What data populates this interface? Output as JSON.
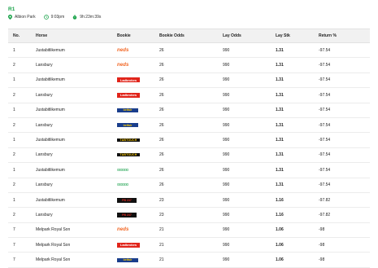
{
  "race": {
    "title": "R1",
    "venue": "Albion Park",
    "time": "9:03pm",
    "countdown": "9h:23m:39s"
  },
  "table": {
    "headers": {
      "no": "No.",
      "horse": "Horse",
      "bookie": "Bookie",
      "bookie_odds": "Bookie Odds",
      "lay_odds": "Lay Odds",
      "lay_stk": "Lay Stk",
      "return": "Return %"
    },
    "rows": [
      {
        "no": "1",
        "horse": "Justabitlikemum",
        "bookie": "neds",
        "bookie_label": "neds",
        "bookie_odds": "26",
        "lay_odds": "990",
        "lay_stk": "1.31",
        "return": "-97.54"
      },
      {
        "no": "2",
        "horse": "Lansbury",
        "bookie": "neds",
        "bookie_label": "neds",
        "bookie_odds": "26",
        "lay_odds": "990",
        "lay_stk": "1.31",
        "return": "-97.54"
      },
      {
        "no": "1",
        "horse": "Justabitlikemum",
        "bookie": "ladbrokes",
        "bookie_label": "Ladbrokes",
        "bookie_odds": "26",
        "lay_odds": "990",
        "lay_stk": "1.31",
        "return": "-97.54"
      },
      {
        "no": "2",
        "horse": "Lansbury",
        "bookie": "ladbrokes",
        "bookie_label": "Ladbrokes",
        "bookie_odds": "26",
        "lay_odds": "990",
        "lay_stk": "1.31",
        "return": "-97.54"
      },
      {
        "no": "1",
        "horse": "Justabitlikemum",
        "bookie": "betfair",
        "bookie_label": "betfair",
        "bookie_odds": "26",
        "lay_odds": "990",
        "lay_stk": "1.31",
        "return": "-97.54"
      },
      {
        "no": "2",
        "horse": "Lansbury",
        "bookie": "betfair",
        "bookie_label": "betfair",
        "bookie_odds": "26",
        "lay_odds": "990",
        "lay_stk": "1.31",
        "return": "-97.54"
      },
      {
        "no": "1",
        "horse": "Justabitlikemum",
        "bookie": "tab",
        "bookie_label": "TABTOUCH",
        "bookie_odds": "26",
        "lay_odds": "990",
        "lay_stk": "1.31",
        "return": "-97.54"
      },
      {
        "no": "2",
        "horse": "Lansbury",
        "bookie": "tab",
        "bookie_label": "TABTOUCH",
        "bookie_odds": "26",
        "lay_odds": "990",
        "lay_stk": "1.31",
        "return": "-97.54"
      },
      {
        "no": "1",
        "horse": "Justabitlikemum",
        "bookie": "green",
        "bookie_label": "oooooo",
        "bookie_odds": "26",
        "lay_odds": "990",
        "lay_stk": "1.31",
        "return": "-97.54"
      },
      {
        "no": "2",
        "horse": "Lansbury",
        "bookie": "green",
        "bookie_label": "oooooo",
        "bookie_odds": "26",
        "lay_odds": "990",
        "lay_stk": "1.31",
        "return": "-97.54"
      },
      {
        "no": "1",
        "horse": "Justabitlikemum",
        "bookie": "pb",
        "bookie_label": "PB 247",
        "bookie_odds": "23",
        "lay_odds": "990",
        "lay_stk": "1.16",
        "return": "-97.82"
      },
      {
        "no": "2",
        "horse": "Lansbury",
        "bookie": "pb",
        "bookie_label": "PB 247",
        "bookie_odds": "23",
        "lay_odds": "990",
        "lay_stk": "1.16",
        "return": "-97.82"
      },
      {
        "no": "7",
        "horse": "Melpark Royal Son",
        "bookie": "neds",
        "bookie_label": "neds",
        "bookie_odds": "21",
        "lay_odds": "990",
        "lay_stk": "1.06",
        "return": "-98"
      },
      {
        "no": "7",
        "horse": "Melpark Royal Son",
        "bookie": "ladbrokes",
        "bookie_label": "Ladbrokes",
        "bookie_odds": "21",
        "lay_odds": "990",
        "lay_stk": "1.06",
        "return": "-98"
      },
      {
        "no": "7",
        "horse": "Melpark Royal Son",
        "bookie": "betfair",
        "bookie_label": "betfair",
        "bookie_odds": "21",
        "lay_odds": "990",
        "lay_stk": "1.06",
        "return": "-98"
      }
    ]
  },
  "colors": {
    "accent": "#1aa34a"
  }
}
